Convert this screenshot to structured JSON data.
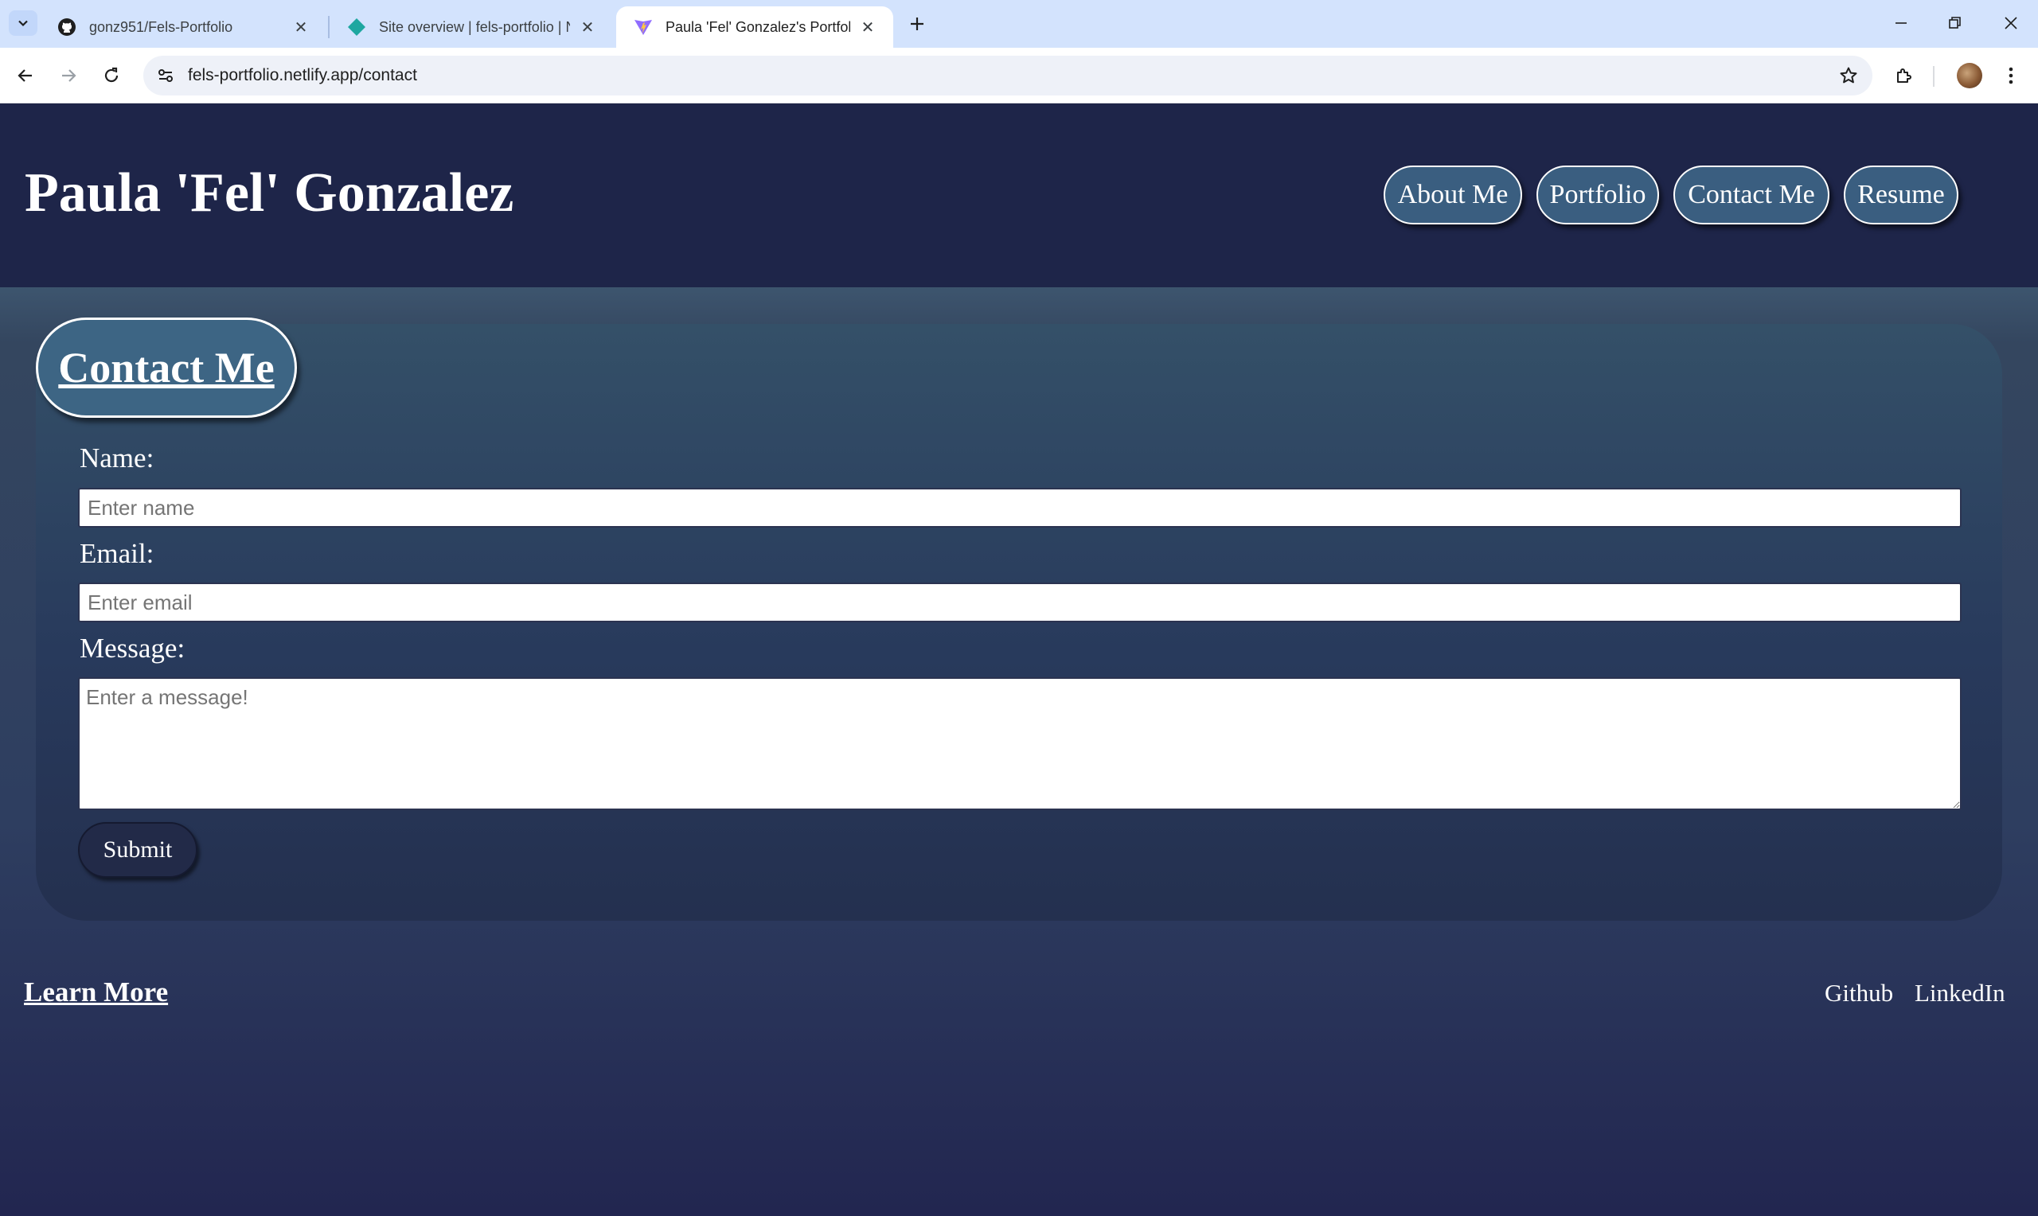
{
  "browser": {
    "tabs": [
      {
        "title": "gonz951/Fels-Portfolio",
        "icon": "github-icon",
        "active": false
      },
      {
        "title": "Site overview | fels-portfolio | N",
        "icon": "netlify-icon",
        "active": false
      },
      {
        "title": "Paula 'Fel' Gonzalez's Portfolio",
        "icon": "vite-icon",
        "active": true
      }
    ],
    "address": "fels-portfolio.netlify.app/contact"
  },
  "header": {
    "title": "Paula 'Fel' Gonzalez",
    "nav": [
      {
        "label": "About Me"
      },
      {
        "label": "Portfolio"
      },
      {
        "label": "Contact Me"
      },
      {
        "label": "Resume"
      }
    ]
  },
  "contact": {
    "heading": "Contact Me",
    "name_label": "Name:",
    "name_placeholder": "Enter name",
    "email_label": "Email:",
    "email_placeholder": "Enter email",
    "message_label": "Message:",
    "message_placeholder": "Enter a message!",
    "submit_label": "Submit"
  },
  "footer": {
    "learn_more": "Learn More",
    "links": [
      {
        "label": "Github"
      },
      {
        "label": "LinkedIn"
      }
    ]
  },
  "colors": {
    "header_bg": "#1e2549",
    "accent_button": "#3a5e80",
    "card_top": "#345068",
    "page_bottom": "#222650"
  }
}
